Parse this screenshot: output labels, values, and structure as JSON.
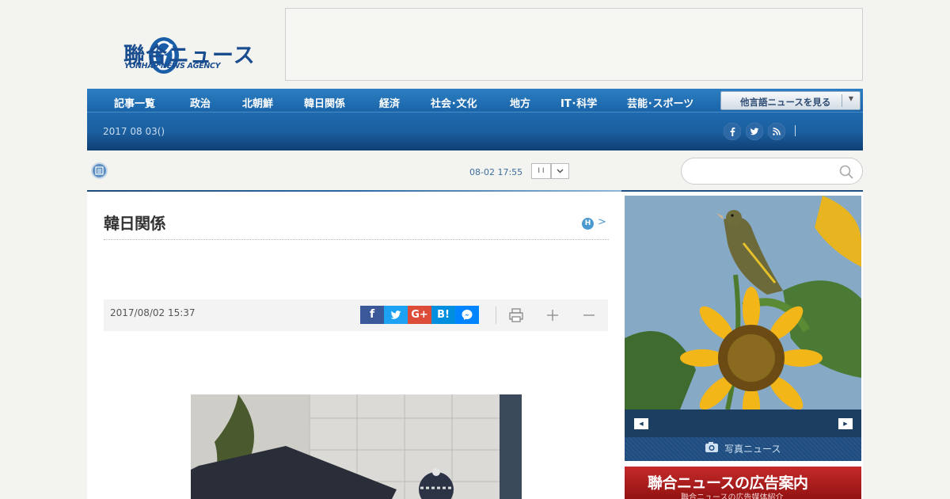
{
  "header": {
    "logo_text": "聯合ニュース",
    "logo_subtitle": "YONHAP NEWS AGENCY"
  },
  "nav": {
    "items": [
      "記事一覧",
      "政治",
      "北朝鮮",
      "韓日関係",
      "経済",
      "社会･文化",
      "地方",
      "IT･科学",
      "芸能･スポーツ"
    ],
    "language_button": "他言語ニュースを見る",
    "date": "2017 08 03()"
  },
  "ticker": {
    "time": "08-02 17:55",
    "pause_label": "I I"
  },
  "search": {
    "placeholder": ""
  },
  "article": {
    "section_title": "韓日関係",
    "section_badge": "H",
    "section_more": ">",
    "date": "2017/08/02 15:37",
    "share_buttons": [
      {
        "icon": "facebook-icon",
        "label": "f",
        "color": "#3b5998"
      },
      {
        "icon": "twitter-icon",
        "label": "",
        "color": "#1da1f2"
      },
      {
        "icon": "googleplus-icon",
        "label": "G+",
        "color": "#dd4b39"
      },
      {
        "icon": "hatena-icon",
        "label": "B!",
        "color": "#008fde"
      },
      {
        "icon": "messenger-icon",
        "label": "",
        "color": "#0084ff"
      }
    ]
  },
  "sidebar": {
    "photo_caption": "写真ニュース",
    "ad_title": "聯合ニュースの広告案内",
    "ad_subtitle": "聯合ニュースの広告媒体紹介"
  },
  "colors": {
    "brand_blue": "#1a4d8f",
    "nav_blue": "#1e6bb0",
    "accent_red": "#c52a2a"
  }
}
